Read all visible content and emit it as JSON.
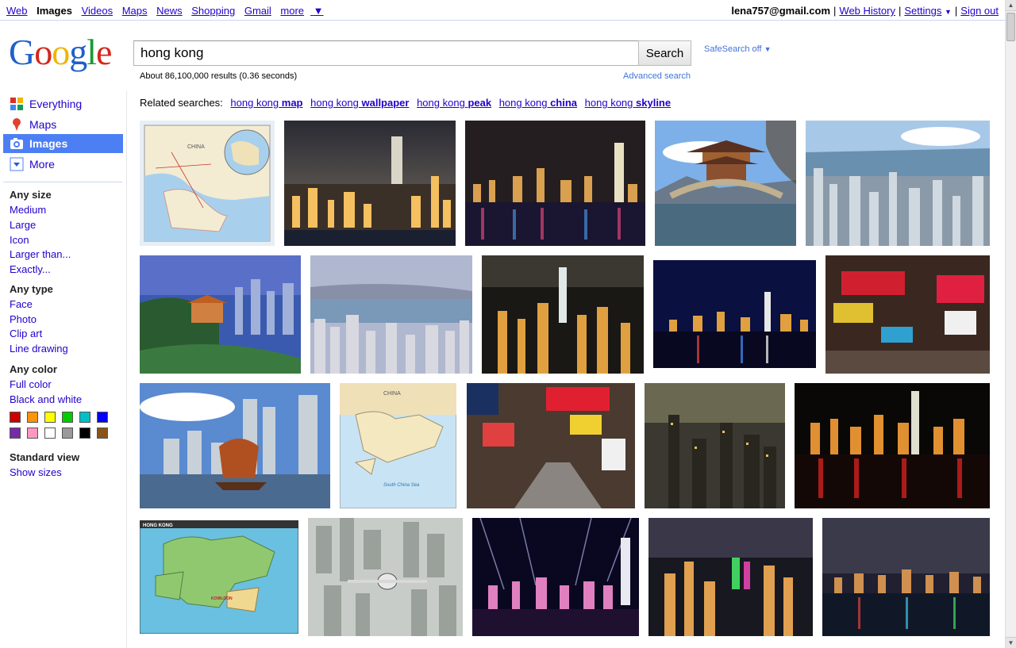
{
  "topnav": {
    "items": [
      {
        "label": "Web",
        "active": false
      },
      {
        "label": "Images",
        "active": true
      },
      {
        "label": "Videos",
        "active": false
      },
      {
        "label": "Maps",
        "active": false
      },
      {
        "label": "News",
        "active": false
      },
      {
        "label": "Shopping",
        "active": false
      },
      {
        "label": "Gmail",
        "active": false
      },
      {
        "label": "more",
        "active": false
      }
    ],
    "account": "lena757@gmail.com",
    "web_history": "Web History",
    "settings": "Settings",
    "sign_out": "Sign out",
    "separator": "|"
  },
  "logo": {
    "letters": [
      "G",
      "o",
      "o",
      "g",
      "l",
      "e"
    ]
  },
  "search": {
    "query": "hong kong",
    "button_label": "Search",
    "safesearch": "SafeSearch off",
    "result_stats": "About 86,100,000 results (0.36 seconds)",
    "advanced_search": "Advanced search"
  },
  "sidebar": {
    "modes": [
      {
        "label": "Everything",
        "icon": "everything-icon"
      },
      {
        "label": "Maps",
        "icon": "maps-pin-icon"
      },
      {
        "label": "Images",
        "icon": "camera-icon",
        "active": true
      },
      {
        "label": "More",
        "icon": "chevron-down-icon"
      }
    ],
    "size": {
      "heading": "Any size",
      "options": [
        "Medium",
        "Large",
        "Icon",
        "Larger than...",
        "Exactly..."
      ]
    },
    "type": {
      "heading": "Any type",
      "options": [
        "Face",
        "Photo",
        "Clip art",
        "Line drawing"
      ]
    },
    "color": {
      "heading": "Any color",
      "options": [
        "Full color",
        "Black and white"
      ],
      "swatches": [
        "#cc0000",
        "#fb940b",
        "#ffff00",
        "#00cc00",
        "#03c0c6",
        "#0000ff",
        "#762ca7",
        "#ff98bf",
        "#ffffff",
        "#999999",
        "#000000",
        "#885418"
      ]
    },
    "view": {
      "heading": "Standard view",
      "options": [
        "Show sizes"
      ]
    }
  },
  "related": {
    "label": "Related searches:",
    "items": [
      {
        "prefix": "hong kong",
        "bold": "map"
      },
      {
        "prefix": "hong kong",
        "bold": "wallpaper"
      },
      {
        "prefix": "hong kong",
        "bold": "peak"
      },
      {
        "prefix": "hong kong",
        "bold": "china"
      },
      {
        "prefix": "hong kong",
        "bold": "skyline"
      }
    ]
  },
  "map_labels": {
    "thumb1_china": "CHINA",
    "thumb12_china": "CHINA",
    "thumb12_sea": "South China Sea",
    "thumb16_title": "HONG KONG",
    "thumb16_kowloon": "KOWLOON"
  },
  "colors": {
    "link": "#2200cc",
    "active_mode_bg": "#4d7ff4",
    "topbar_border": "#c9d7f1",
    "secondary_link": "#4272db"
  }
}
